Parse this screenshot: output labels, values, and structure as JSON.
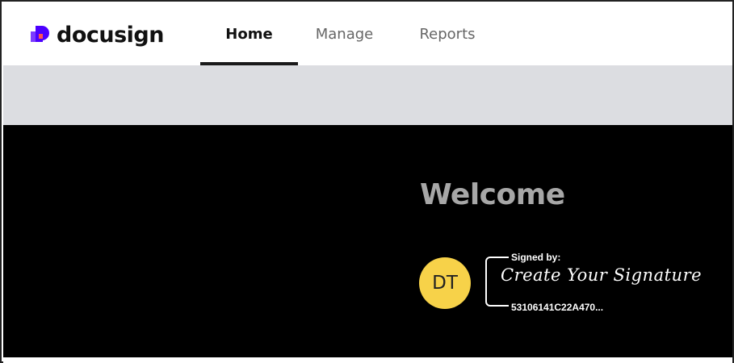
{
  "app": {
    "logo_text": "docusign",
    "colors": {
      "logo_primary": "#4C00FF",
      "logo_accent": "#FF5252",
      "avatar_bg": "#F7D249",
      "welcome_text": "#A7A7A7",
      "panel_bg": "#000000",
      "band_bg": "#DCDDE1"
    }
  },
  "nav": {
    "tabs": [
      {
        "label": "Home",
        "active": true
      },
      {
        "label": "Manage",
        "active": false
      },
      {
        "label": "Reports",
        "active": false
      }
    ]
  },
  "main": {
    "welcome": "Welcome",
    "avatar_initials": "DT",
    "signature": {
      "signed_by_label": "Signed by:",
      "signature_text": "Create Your Signature",
      "signature_id": "53106141C22A470..."
    }
  }
}
